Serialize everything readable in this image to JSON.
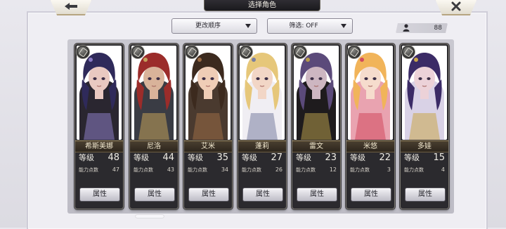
{
  "header": {
    "title": "选择角色"
  },
  "controls": {
    "sort_label": "更改顺序",
    "filter_label": "筛选: OFF",
    "owned_count": "88"
  },
  "labels": {
    "level": "等级",
    "ability_points": "能力点数",
    "attr_button": "属性"
  },
  "characters": [
    {
      "name": "希斯美娜",
      "level": "48",
      "points": "47",
      "hair": "#2f2a5a",
      "skin": "#e9c9c1",
      "outfit": "#2a2630",
      "accent": "#8a7bc4"
    },
    {
      "name": "尼洛",
      "level": "44",
      "points": "43",
      "hair": "#9b2c2a",
      "skin": "#d9b39a",
      "outfit": "#3a3c44",
      "accent": "#c3a15a"
    },
    {
      "name": "艾米",
      "level": "35",
      "points": "34",
      "hair": "#3c2a1e",
      "skin": "#efcdb6",
      "outfit": "#4a3a2f",
      "accent": "#9a6b45"
    },
    {
      "name": "蓬莉",
      "level": "27",
      "points": "26",
      "hair": "#e6c77a",
      "skin": "#f2d6c6",
      "outfit": "#f0eef3",
      "accent": "#7a7fa0"
    },
    {
      "name": "雷文",
      "level": "23",
      "points": "12",
      "hair": "#5b4a7a",
      "skin": "#cdb6c1",
      "outfit": "#1e1b1d",
      "accent": "#b49a4a"
    },
    {
      "name": "米悠",
      "level": "22",
      "points": "3",
      "hair": "#f1b45a",
      "skin": "#f6dccd",
      "outfit": "#e9a3b0",
      "accent": "#d24a5e"
    },
    {
      "name": "多娃",
      "level": "15",
      "points": "4",
      "hair": "#3b2b66",
      "skin": "#ecd2d8",
      "outfit": "#d9d2e6",
      "accent": "#c8a54a"
    }
  ]
}
